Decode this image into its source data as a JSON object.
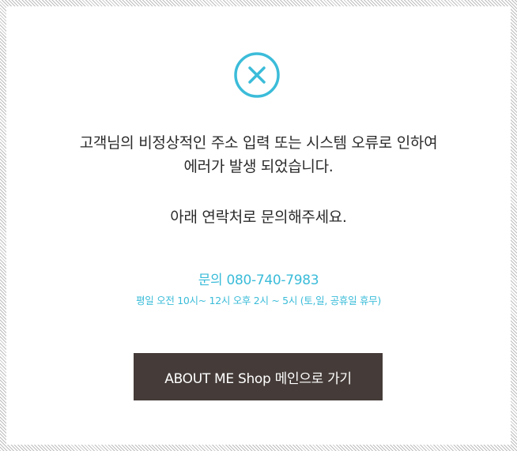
{
  "error_icon": {
    "name": "close-circle-icon",
    "color": "#3bbcd9"
  },
  "message": {
    "line1": "고객님의 비정상적인 주소 입력 또는 시스템 오류로 인하여",
    "line2": "에러가 발생 되었습니다.",
    "line3": "아래 연락처로 문의해주세요."
  },
  "contact": {
    "phone": "문의 080-740-7983",
    "hours": "평일 오전 10시~ 12시 오후 2시 ~ 5시 (토,일, 공휴일 휴무)"
  },
  "main_button": {
    "label": "ABOUT ME Shop 메인으로 가기",
    "background": "#453c39"
  }
}
